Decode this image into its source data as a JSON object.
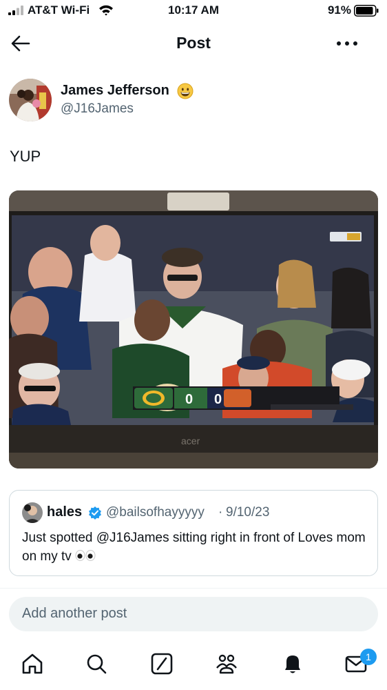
{
  "status_bar": {
    "carrier": "AT&T Wi-Fi",
    "time": "10:17 AM",
    "battery": "91%",
    "battery_level": 0.91
  },
  "nav": {
    "title": "Post",
    "back_icon": "arrow-left-icon",
    "more_icon": "more-horizontal-icon"
  },
  "post": {
    "author_name": "James Jefferson",
    "author_emoji": "grinning-face-emoji",
    "author_handle": "@J16James",
    "text": "YUP",
    "media": {
      "description_icon": "tv-screenshot-image",
      "score_home": "0",
      "score_away": "0",
      "tv_brand": "acer"
    }
  },
  "quote": {
    "name": "hales",
    "verified_icon": "verified-badge-icon",
    "handle": "@bailsofhayyyyy",
    "separator": "·",
    "date": "9/10/23",
    "text": "Just spotted @J16James sitting right in front of Loves mom on my tv",
    "emoji": "eyes-emoji"
  },
  "reply_box": {
    "placeholder": "Add another post"
  },
  "tab_bar": {
    "items": [
      "home-icon",
      "search-icon",
      "grok-icon",
      "communities-icon",
      "notifications-icon",
      "messages-icon"
    ],
    "messages_badge": "1"
  },
  "colors": {
    "text": "#0f1419",
    "secondary": "#536471",
    "accent": "#1d9bf0",
    "border": "#cfd9de"
  }
}
